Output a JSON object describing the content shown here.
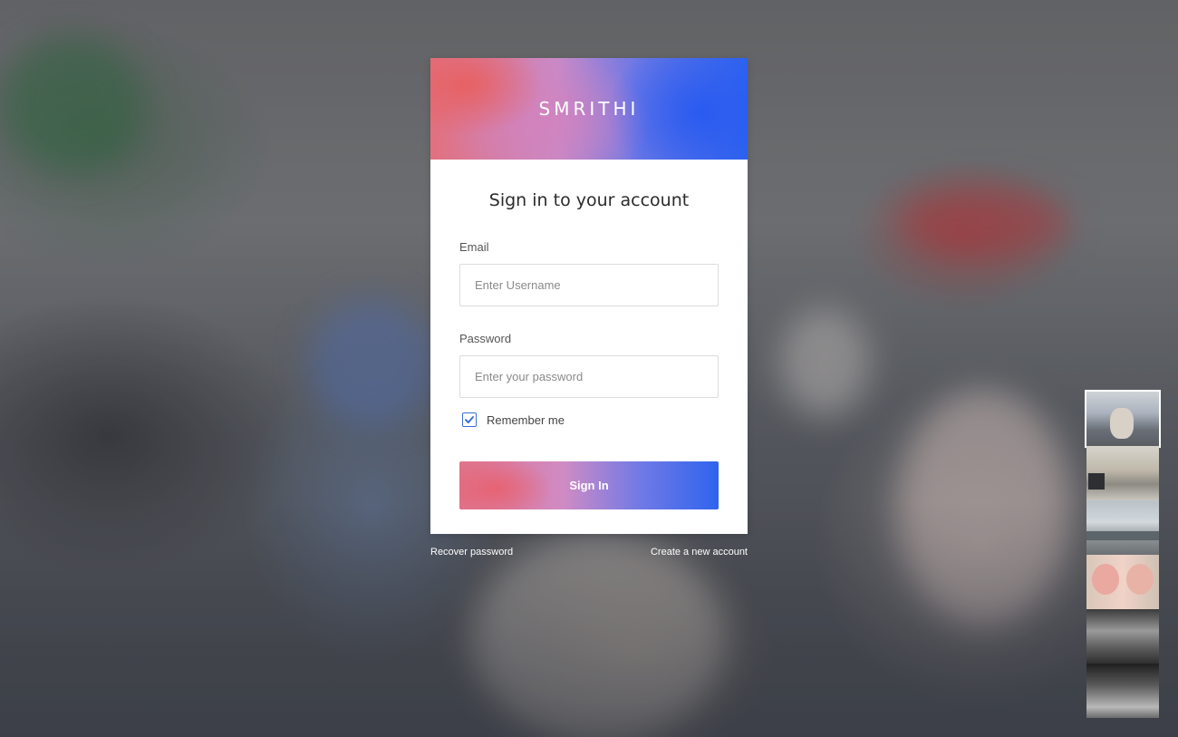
{
  "brand": "SMRITHI",
  "login": {
    "title": "Sign in to your account",
    "email_label": "Email",
    "email_placeholder": "Enter Username",
    "email_value": "",
    "password_label": "Password",
    "password_placeholder": "Enter your password",
    "password_value": "",
    "remember_label": "Remember me",
    "remember_checked": true,
    "submit_label": "Sign In"
  },
  "links": {
    "recover": "Recover password",
    "create": "Create a new account"
  },
  "colors": {
    "gradient_start": "#e2707f",
    "gradient_mid": "#c98ac7",
    "gradient_end": "#2c63ef",
    "checkbox_accent": "#3a6fd8"
  },
  "gallery": {
    "thumbnails": [
      {
        "name": "thumbnail-street-scooters",
        "active": true
      },
      {
        "name": "thumbnail-street-van",
        "active": false
      },
      {
        "name": "thumbnail-river-city",
        "active": false
      },
      {
        "name": "thumbnail-babies",
        "active": false
      },
      {
        "name": "thumbnail-sleeping-dog",
        "active": false
      },
      {
        "name": "thumbnail-dark-alley",
        "active": false
      }
    ]
  }
}
